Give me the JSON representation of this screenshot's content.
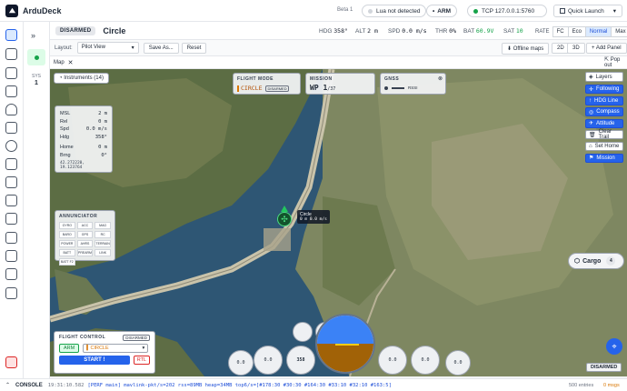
{
  "app": {
    "title": "ArduDeck",
    "beta": "Beta 1"
  },
  "header": {
    "lua_status": "Lua not detected",
    "arm_label": "ARM",
    "connection": "TCP 127.0.0.1:5760",
    "quick_launch": "Quick Launch"
  },
  "status": {
    "armed_state": "DISARMED",
    "mode": "Circle",
    "hdg_label": "HDG",
    "hdg_value": "358°",
    "alt_label": "ALT",
    "alt_value": "2 m",
    "spd_label": "SPD",
    "spd_value": "0.0 m/s",
    "thr_label": "THR",
    "thr_value": "0%",
    "bat_label": "BAT",
    "bat_value": "60.9V",
    "sat_label": "SAT",
    "sat_value": "10",
    "rate_label": "RATE",
    "rate_options": [
      "FC",
      "Eco",
      "Normal",
      "Max"
    ],
    "rate_selected": "Normal"
  },
  "sidebar": {
    "sys_label": "SYS",
    "sys_value": "1"
  },
  "layout_bar": {
    "layout_label": "Layout:",
    "layout_value": "Pilot View",
    "save_as": "Save As...",
    "reset": "Reset",
    "offline_maps": "Offline maps",
    "view_2d": "2D",
    "view_3d": "3D",
    "add_panel": "+ Add Panel"
  },
  "map_tab": {
    "label": "Map",
    "pop_out": "Pop out"
  },
  "instruments": {
    "label": "Instruments (14)"
  },
  "telemetry_panel": {
    "rows": [
      {
        "label": "MSL",
        "value": "2 m"
      },
      {
        "label": "Rel",
        "value": "0 m"
      },
      {
        "label": "Spd",
        "value": "0.0 m/s"
      },
      {
        "label": "Hdg",
        "value": "358°"
      },
      {
        "label": "Home",
        "value": "0 m"
      },
      {
        "label": "Brng",
        "value": "0°"
      }
    ],
    "coords": "42.272220, 19.123764"
  },
  "flight_mode_card": {
    "title": "FLIGHT MODE",
    "value": "CIRCLE",
    "badge": "DISARMED"
  },
  "mission_card": {
    "title": "MISSION",
    "value": "WP 1",
    "total": "/37"
  },
  "gnss_card": {
    "title": "GNSS",
    "value": "RSSI"
  },
  "annunciator": {
    "title": "ANNUNCIATOR",
    "items": [
      "GYRO",
      "ACC",
      "MAG",
      "BARO",
      "GPS",
      "RC",
      "POWER",
      "AHRS",
      "TERRAIN",
      "BATT",
      "PREARM",
      "LINK",
      "BATT F2"
    ]
  },
  "vehicle_label": {
    "name": "Circle",
    "detail": "0 m 0.0 m/s"
  },
  "layers": {
    "title": "Layers",
    "items": [
      {
        "label": "Following",
        "active": true
      },
      {
        "label": "HDG Line",
        "active": true
      },
      {
        "label": "Compass",
        "active": true
      },
      {
        "label": "Attitude",
        "active": true
      },
      {
        "label": "Clear Trail",
        "active": false
      },
      {
        "label": "Set Home",
        "active": false
      },
      {
        "label": "Mission",
        "active": true
      }
    ]
  },
  "cargo": {
    "label": "Cargo",
    "count": "4"
  },
  "flight_control": {
    "title": "FLIGHT CONTROL",
    "badge": "DISARMED",
    "arm": "ARM",
    "mode": "CIRCLE",
    "start": "START !",
    "rtl": "RTL"
  },
  "gauges": {
    "g1": "0.0",
    "g2": "0.0",
    "g3": "358",
    "g4": "0.0",
    "g5": "0.0",
    "g6": "0.0"
  },
  "map_badge": "DISARMED",
  "console": {
    "label": "CONSOLE",
    "time": "19:31:10.582",
    "message": "[PERF main] mavlink-pkt/s=202 rss=89MB heap=34MB top6/s=[#178:30 #30:30 #164:30 #33:10 #32:10 #163:5]",
    "entries": "500 entries",
    "msgs": "0 msgs"
  },
  "colors": {
    "accent": "#2563eb",
    "green": "#16a34a",
    "amber": "#d97706",
    "map_water": "#2f5775"
  }
}
